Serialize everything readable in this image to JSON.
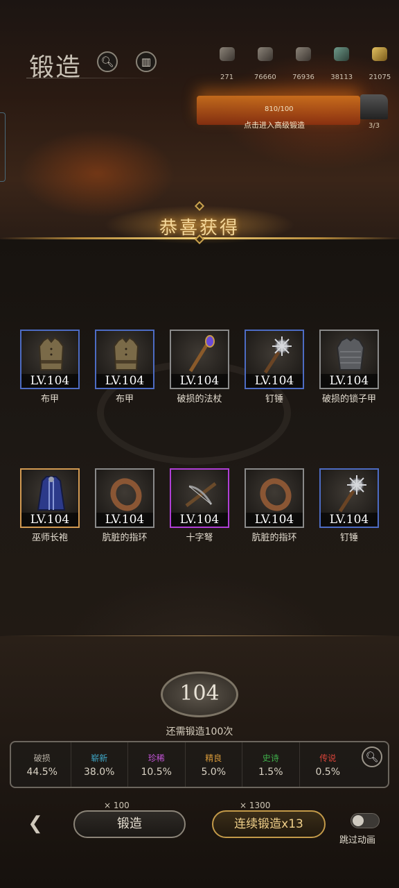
{
  "header": {
    "title": "锻造",
    "search_icon": "magnifier-icon",
    "book_icon": "book-icon"
  },
  "resources": [
    {
      "icon": "ore-icon",
      "value": "271"
    },
    {
      "icon": "ingot-icon",
      "value": "76660"
    },
    {
      "icon": "stone-icon",
      "value": "76936"
    },
    {
      "icon": "gem-icon",
      "value": "38113"
    },
    {
      "icon": "gold-icon",
      "value": "21075"
    }
  ],
  "forge": {
    "progress_text": "810/100",
    "hint": "点击进入高级锻造",
    "anvil_count": "3/3"
  },
  "banner": {
    "title": "恭喜获得"
  },
  "items": [
    {
      "level": "LV.104",
      "name": "布甲",
      "rarity": "blue",
      "color": "#4d6cc4",
      "icon": "vest-icon"
    },
    {
      "level": "LV.104",
      "name": "布甲",
      "rarity": "blue",
      "color": "#4d6cc4",
      "icon": "vest-icon"
    },
    {
      "level": "LV.104",
      "name": "破损的法杖",
      "rarity": "gray",
      "color": "#8a8a8a",
      "icon": "staff-icon"
    },
    {
      "level": "LV.104",
      "name": "钉锤",
      "rarity": "blue",
      "color": "#4d6cc4",
      "icon": "mace-icon"
    },
    {
      "level": "LV.104",
      "name": "破损的锁子甲",
      "rarity": "gray",
      "color": "#8a8a8a",
      "icon": "chainmail-icon"
    },
    {
      "level": "LV.104",
      "name": "巫师长袍",
      "rarity": "orange",
      "color": "#d29a52",
      "icon": "robe-icon"
    },
    {
      "level": "LV.104",
      "name": "肮脏的指环",
      "rarity": "gray",
      "color": "#8a8a8a",
      "icon": "ring-icon"
    },
    {
      "level": "LV.104",
      "name": "十字弩",
      "rarity": "purple",
      "color": "#b03fd6",
      "icon": "crossbow-icon"
    },
    {
      "level": "LV.104",
      "name": "肮脏的指环",
      "rarity": "gray",
      "color": "#8a8a8a",
      "icon": "ring-icon"
    },
    {
      "level": "LV.104",
      "name": "钉锤",
      "rarity": "blue",
      "color": "#4d6cc4",
      "icon": "mace-icon"
    }
  ],
  "forge_level": {
    "value": "104",
    "description": "还需锻造100次"
  },
  "rates": [
    {
      "name": "破损",
      "value": "44.5%",
      "color": "#b9b2a6"
    },
    {
      "name": "崭新",
      "value": "38.0%",
      "color": "#3fa8c8"
    },
    {
      "name": "珍稀",
      "value": "10.5%",
      "color": "#c454d8"
    },
    {
      "name": "精良",
      "value": "5.0%",
      "color": "#d89a3a"
    },
    {
      "name": "史诗",
      "value": "1.5%",
      "color": "#3fae4a"
    },
    {
      "name": "传说",
      "value": "0.5%",
      "color": "#d8443a"
    }
  ],
  "actions": {
    "forge_label": "锻造",
    "forge_cost": "× 100",
    "multi_label": "连续锻造x13",
    "multi_cost": "× 1300",
    "skip_label": "跳过动画"
  }
}
